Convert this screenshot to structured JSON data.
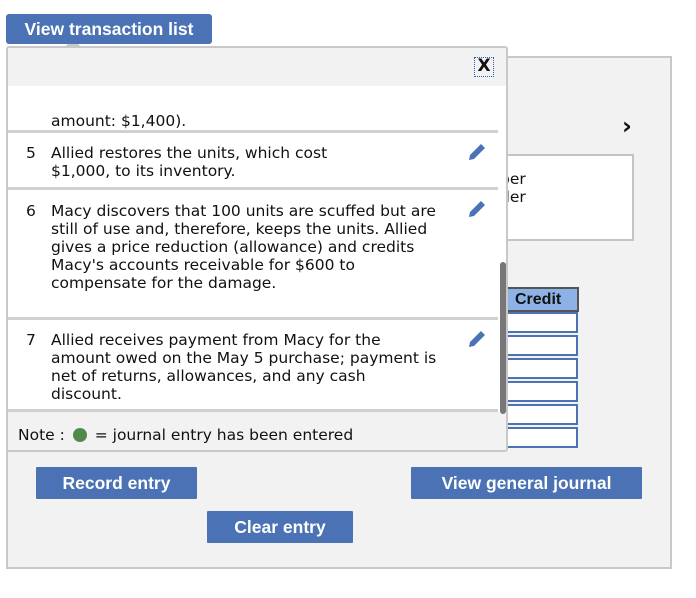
{
  "view_transaction_list_label": "View transaction list",
  "close_label": "X",
  "partial_text": "amount: $1,400).",
  "transactions": [
    {
      "num": "5",
      "text": "Allied restores the units, which cost $1,000, to its inventory."
    },
    {
      "num": "6",
      "text": "Macy discovers that 100 units are scuffed but are still of use and, therefore, keeps the units. Allied gives a price reduction (allowance) and credits Macy's accounts receivable for $600 to compensate for the damage."
    },
    {
      "num": "7",
      "text": "Allied receives payment from Macy for the amount owed on the May 5 purchase; payment is net of returns, allowances, and any cash discount."
    }
  ],
  "note": {
    "prefix": "Note :",
    "suffix": "= journal entry has been entered",
    "dot_color": "#4f8a4a"
  },
  "background_box": {
    "line1": "ber",
    "line2": "der"
  },
  "credit_header": "Credit",
  "buttons": {
    "record": "Record entry",
    "view_journal": "View general journal",
    "clear": "Clear entry"
  },
  "icons": {
    "next": "chevron-right-icon",
    "edit": "pencil-icon"
  },
  "accent": "#4a72b4"
}
